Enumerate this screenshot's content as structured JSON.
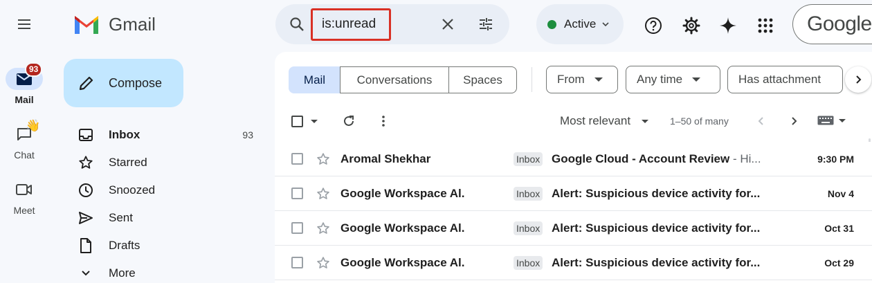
{
  "rail": {
    "mail": {
      "label": "Mail",
      "badge": "93"
    },
    "chat": {
      "label": "Chat",
      "emoji": "👋"
    },
    "meet": {
      "label": "Meet"
    }
  },
  "header": {
    "logo_text": "Gmail",
    "search_value": "is:unread",
    "status": "Active",
    "account_logo_text": "Google"
  },
  "compose_label": "Compose",
  "nav": [
    {
      "label": "Inbox",
      "count": "93"
    },
    {
      "label": "Starred",
      "count": ""
    },
    {
      "label": "Snoozed",
      "count": ""
    },
    {
      "label": "Sent",
      "count": ""
    },
    {
      "label": "Drafts",
      "count": ""
    },
    {
      "label": "More",
      "count": ""
    }
  ],
  "filters": {
    "segments": [
      "Mail",
      "Conversations",
      "Spaces"
    ],
    "chips": [
      "From",
      "Any time",
      "Has attachment"
    ]
  },
  "toolbar": {
    "sort": "Most relevant",
    "range": "1–50 of many"
  },
  "emails": [
    {
      "sender": "Aromal Shekhar",
      "label": "Inbox",
      "subject": "Google Cloud - Account Review",
      "snippet": " - Hi...",
      "date": "9:30 PM"
    },
    {
      "sender": "Google Workspace Al.",
      "label": "Inbox",
      "subject": "Alert: Suspicious device activity for...",
      "snippet": "",
      "date": "Nov 4"
    },
    {
      "sender": "Google Workspace Al.",
      "label": "Inbox",
      "subject": "Alert: Suspicious device activity for...",
      "snippet": "",
      "date": "Oct 31"
    },
    {
      "sender": "Google Workspace Al.",
      "label": "Inbox",
      "subject": "Alert: Suspicious device activity for...",
      "snippet": "",
      "date": "Oct 29"
    }
  ],
  "colors": {
    "accent": "#0b57d0",
    "compose_bg": "#c2e7ff",
    "selected_segment": "#d3e3fd",
    "badge": "#b3261e",
    "highlight_box": "#d93025",
    "active_dot": "#1e8e3e"
  }
}
